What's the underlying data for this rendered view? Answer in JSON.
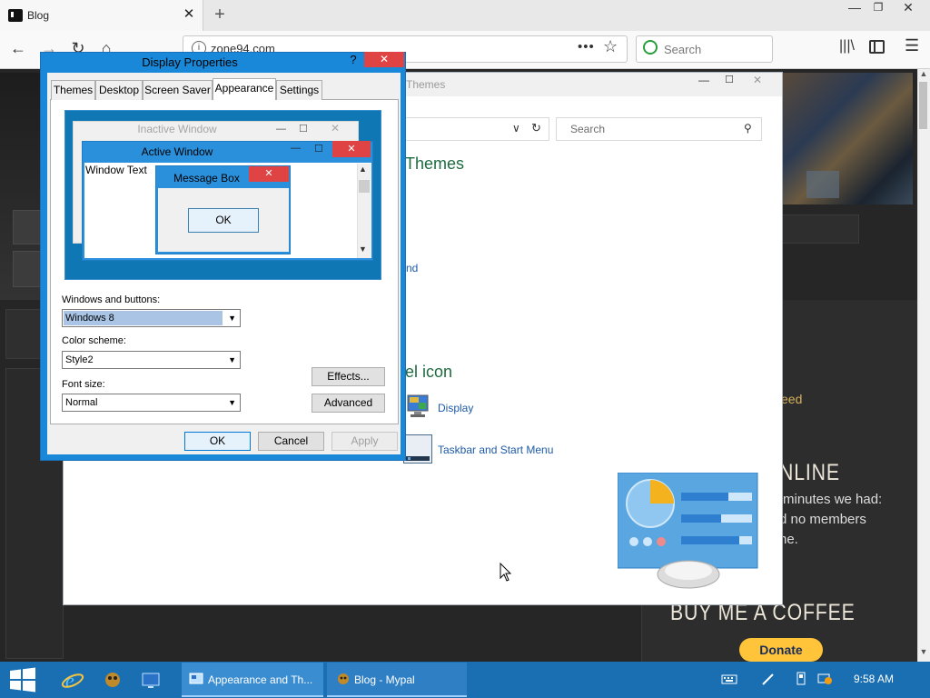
{
  "browser": {
    "tab_title": "Blog",
    "new_tab_symbol": "+",
    "url": "zone94.com",
    "search_placeholder": "Search",
    "window_controls": {
      "minimize": "—",
      "maximize": "❐",
      "close": "✕"
    }
  },
  "webpage": {
    "feed_text": "eed",
    "online_title": "NLINE",
    "online_lines": [
      "minutes we had:",
      "d no members",
      "ne."
    ],
    "coffee_title": "BUY ME A COFFEE",
    "donate_label": "Donate"
  },
  "control_panel": {
    "title": "Themes",
    "search_placeholder": "Search",
    "heading_partial_1": "Themes",
    "link_partial": "nd",
    "heading_partial_2": "el icon",
    "links": [
      "Display",
      "Taskbar and Start Menu"
    ]
  },
  "display_properties": {
    "title": "Display Properties",
    "help_label": "?",
    "tabs": [
      "Themes",
      "Desktop",
      "Screen Saver",
      "Appearance",
      "Settings"
    ],
    "active_tab": "Appearance",
    "preview": {
      "inactive_title": "Inactive Window",
      "active_title": "Active Window",
      "window_text": "Window Text",
      "message_box_title": "Message Box",
      "ok_label": "OK"
    },
    "windows_and_buttons_label": "Windows and buttons:",
    "windows_and_buttons_value": "Windows 8",
    "color_scheme_label": "Color scheme:",
    "color_scheme_value": "Style2",
    "font_size_label": "Font size:",
    "font_size_value": "Normal",
    "effects_label": "Effects...",
    "advanced_label": "Advanced",
    "ok_label": "OK",
    "cancel_label": "Cancel",
    "apply_label": "Apply"
  },
  "taskbar": {
    "tasks": [
      "Appearance and Th...",
      "Blog - Mypal"
    ],
    "clock": "9:58 AM"
  },
  "colors": {
    "taskbar": "#1a6fb3",
    "dialog_frame": "#1a88d8",
    "close_button": "#e04343",
    "cp_heading": "#1e6b3f",
    "link": "#1d5aa8",
    "donate": "#ffc439"
  },
  "icons": [
    "close-icon",
    "plus-icon",
    "back-icon",
    "forward-icon",
    "reload-icon",
    "home-icon",
    "info-icon",
    "page-actions-icon",
    "bookmark-star-icon",
    "search-icon",
    "library-icon",
    "sidebar-icon",
    "menu-icon",
    "windows-logo-icon",
    "ie-icon",
    "folder-icon",
    "display-icon",
    "taskbar-icon",
    "control-panel-icon",
    "cursor-icon"
  ]
}
